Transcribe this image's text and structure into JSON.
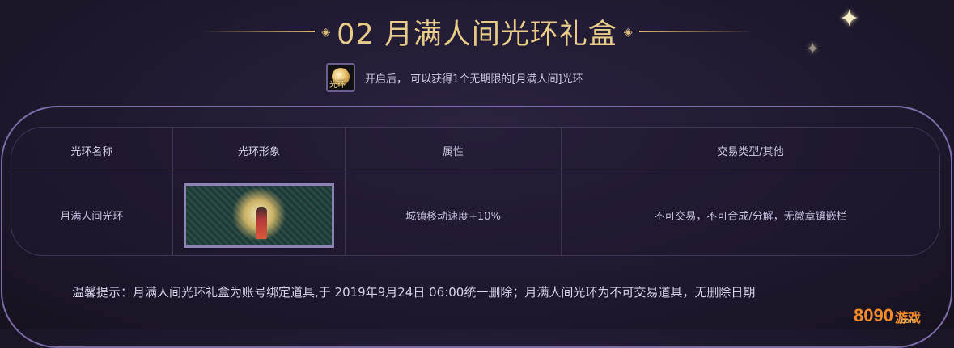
{
  "title": "02 月满人间光环礼盒",
  "description": "开启后， 可以获得1个无期限的[月满人间]光环",
  "item_icon": {
    "name": "halo-item-icon",
    "tag": "光环"
  },
  "table": {
    "headers": [
      "光环名称",
      "光环形象",
      "属性",
      "交易类型/其他"
    ],
    "rows": [
      {
        "name": "月满人间光环",
        "attribute": "城镇移动速度+10%",
        "trade": "不可交易，不可合成/分解，无徽章镶嵌栏"
      }
    ]
  },
  "tip": "温馨提示：月满人间光环礼盒为账号绑定道具,于 2019年9月24日 06:00统一删除；月满人间光环为不可交易道具，无删除日期",
  "logo": {
    "num": "8090",
    "txt": "游戏",
    "sub": ".com"
  },
  "colors": {
    "title_gold": "#e8cc8a",
    "frame_purple": "#7c6ca8",
    "background": "#1f1930"
  }
}
